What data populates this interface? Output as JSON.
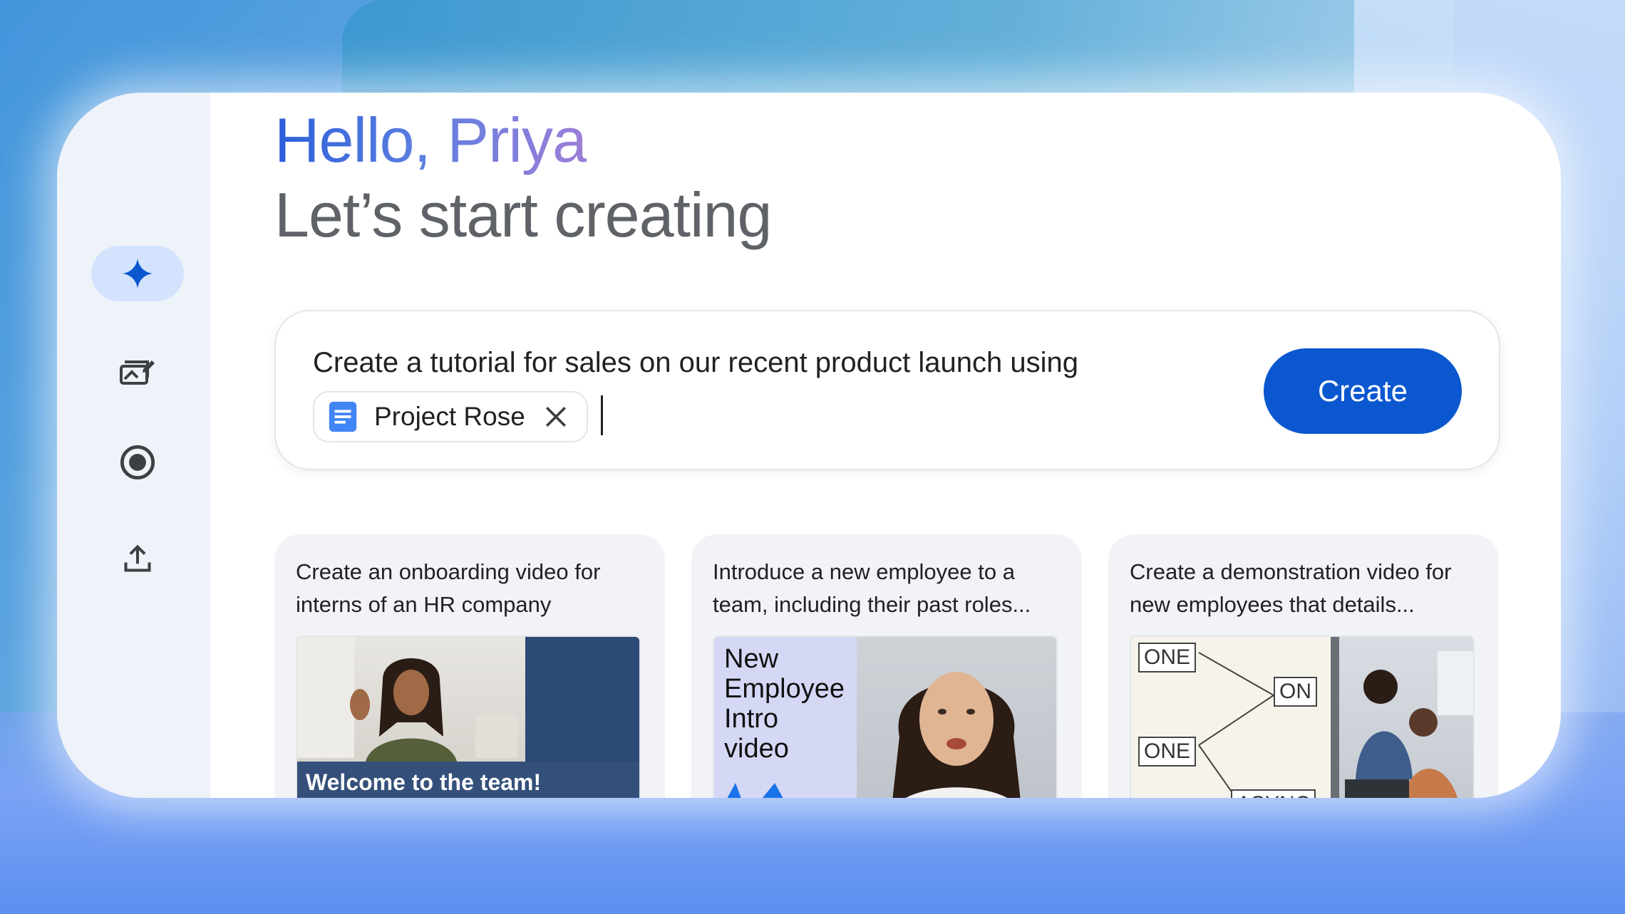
{
  "greeting": "Hello, Priya",
  "subtitle": "Let’s start creating",
  "sidebar": {
    "items": [
      {
        "icon": "sparkle-icon",
        "active": true
      },
      {
        "icon": "gallery-edit-icon",
        "active": false
      },
      {
        "icon": "record-icon",
        "active": false
      },
      {
        "icon": "upload-icon",
        "active": false
      }
    ]
  },
  "prompt": {
    "text": "Create a tutorial for sales on our recent product launch using",
    "chip_label": "Project Rose",
    "create_label": "Create"
  },
  "cards": [
    {
      "title": "Create an onboarding video for interns of an HR company",
      "thumb_caption": "Welcome to the team!"
    },
    {
      "title": "Introduce a new employee to a team, including their past roles...",
      "thumb_line1": "New",
      "thumb_line2": "Employee",
      "thumb_line3": "Intro",
      "thumb_line4": "video"
    },
    {
      "title": "Create a demonstration video for new employees that details...",
      "diagram": [
        "ONE",
        "ON",
        "ONE",
        "ASYNC"
      ]
    }
  ],
  "colors": {
    "primary": "#0b57d0",
    "active_nav": "#d3e3fd",
    "sparkle": "#0b57d0"
  }
}
